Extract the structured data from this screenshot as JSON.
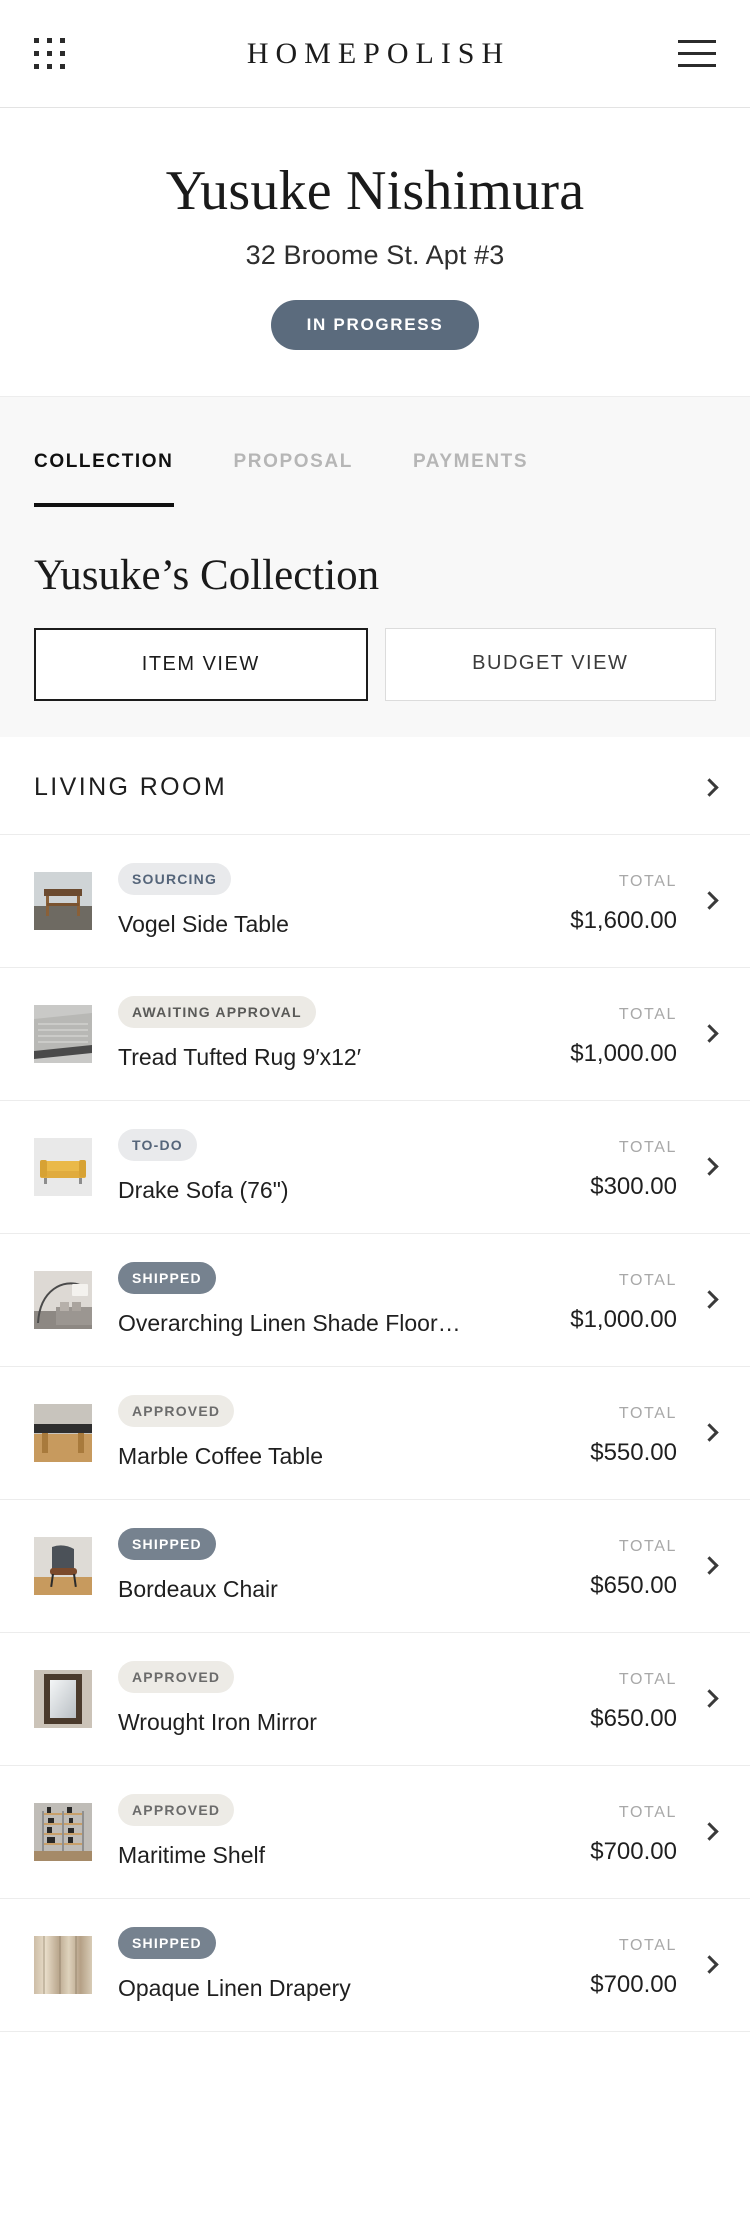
{
  "navbar": {
    "grid_icon": "grid-apps-icon",
    "brand": "HOMEPOLISH",
    "menu_icon": "hamburger-menu-icon"
  },
  "hero": {
    "client_name": "Yusuke Nishimura",
    "address": "32 Broome St. Apt #3",
    "status": "IN PROGRESS",
    "status_color": "#5b6b7d"
  },
  "tabs": [
    {
      "label": "COLLECTION",
      "active": true
    },
    {
      "label": "PROPOSAL",
      "active": false
    },
    {
      "label": "PAYMENTS",
      "active": false
    }
  ],
  "collection": {
    "title": "Yusuke’s Collection",
    "views": [
      {
        "label": "ITEM VIEW",
        "active": true
      },
      {
        "label": "BUDGET VIEW",
        "active": false
      }
    ]
  },
  "room": {
    "name": "LIVING ROOM",
    "chevron_icon": "chevron-right-icon"
  },
  "total_label": "TOTAL",
  "items": [
    {
      "name": "Vogel Side Table",
      "status": "SOURCING",
      "status_class": "sourcing",
      "total": "$1,600.00",
      "thumb": "side-table"
    },
    {
      "name": "Tread Tufted Rug 9′x12′",
      "status": "AWAITING APPROVAL",
      "status_class": "awaiting-approval",
      "total": "$1,000.00",
      "thumb": "rug"
    },
    {
      "name": "Drake Sofa (76\")",
      "status": "TO-DO",
      "status_class": "to-do",
      "total": "$300.00",
      "thumb": "sofa"
    },
    {
      "name": "Overarching Linen Shade Floor…",
      "status": "SHIPPED",
      "status_class": "shipped",
      "total": "$1,000.00",
      "thumb": "floor-lamp"
    },
    {
      "name": "Marble Coffee Table",
      "status": "APPROVED",
      "status_class": "approved",
      "total": "$550.00",
      "thumb": "coffee-table"
    },
    {
      "name": "Bordeaux Chair",
      "status": "SHIPPED",
      "status_class": "shipped",
      "total": "$650.00",
      "thumb": "chair"
    },
    {
      "name": "Wrought Iron Mirror",
      "status": "APPROVED",
      "status_class": "approved",
      "total": "$650.00",
      "thumb": "mirror"
    },
    {
      "name": "Maritime Shelf",
      "status": "APPROVED",
      "status_class": "approved",
      "total": "$700.00",
      "thumb": "shelf"
    },
    {
      "name": "Opaque Linen Drapery",
      "status": "SHIPPED",
      "status_class": "shipped",
      "total": "$700.00",
      "thumb": "drapery"
    }
  ]
}
